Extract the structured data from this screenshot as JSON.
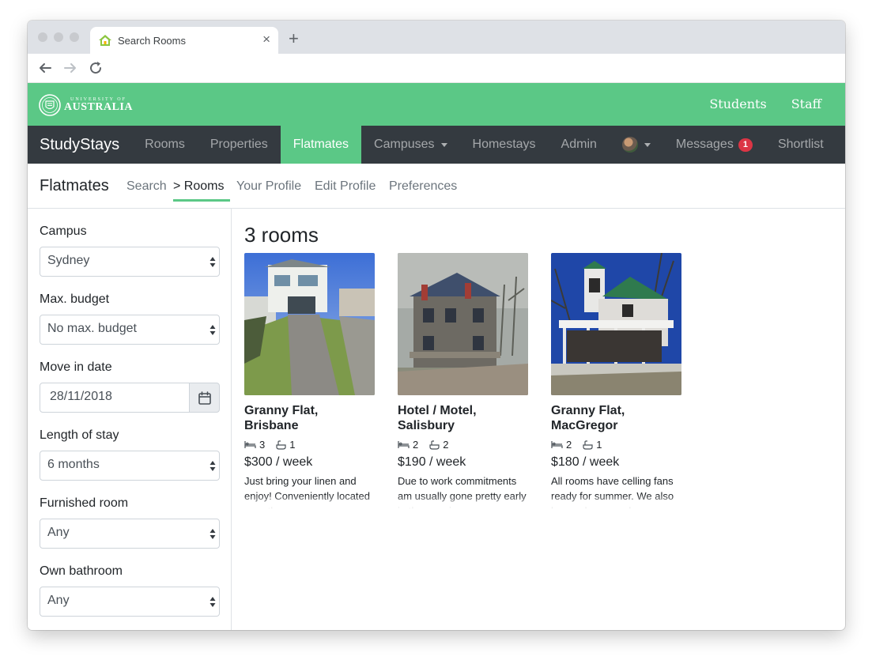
{
  "browser": {
    "tab_title": "Search Rooms",
    "tab_icon": "house-icon",
    "close_icon": "close-icon",
    "new_tab_icon": "plus-icon"
  },
  "university": {
    "logo_small": "UNIVERSITY OF",
    "logo_big": "AUSTRALIA",
    "links": [
      "Students",
      "Staff"
    ]
  },
  "mainnav": {
    "brand": "StudyStays",
    "items": [
      "Rooms",
      "Properties",
      "Flatmates",
      "Campuses",
      "Homestays",
      "Admin"
    ],
    "active": "Flatmates",
    "messages_label": "Messages",
    "messages_count": "1",
    "shortlist": "Shortlist"
  },
  "subnav": {
    "title": "Flatmates",
    "items": [
      "Search",
      "> Rooms",
      "Your Profile",
      "Edit Profile",
      "Preferences"
    ],
    "active": "> Rooms"
  },
  "filters": {
    "campus_label": "Campus",
    "campus_value": "Sydney",
    "budget_label": "Max. budget",
    "budget_value": "No max. budget",
    "move_label": "Move in date",
    "move_value": "28/11/2018",
    "length_label": "Length of stay",
    "length_value": "6 months",
    "furnished_label": "Furnished room",
    "furnished_value": "Any",
    "bathroom_label": "Own bathroom",
    "bathroom_value": "Any"
  },
  "results": {
    "heading": "3 rooms",
    "cards": [
      {
        "title": "Granny Flat, Brisbane",
        "beds": "3",
        "baths": "1",
        "price": "$300 / week",
        "desc": "Just bring your linen and enjoy! Conveniently located near the campus"
      },
      {
        "title": "Hotel / Motel, Salisbury",
        "beds": "2",
        "baths": "2",
        "price": "$190 / week",
        "desc": "Due to work commitments am usually gone pretty early in the morning"
      },
      {
        "title": "Granny Flat, MacGregor",
        "beds": "2",
        "baths": "1",
        "price": "$180 / week",
        "desc": "All rooms have celling fans ready for summer. We also have a large garden"
      }
    ]
  },
  "colors": {
    "brand_green": "#5bc886",
    "nav_dark": "#343a40",
    "badge_red": "#dc3545"
  }
}
